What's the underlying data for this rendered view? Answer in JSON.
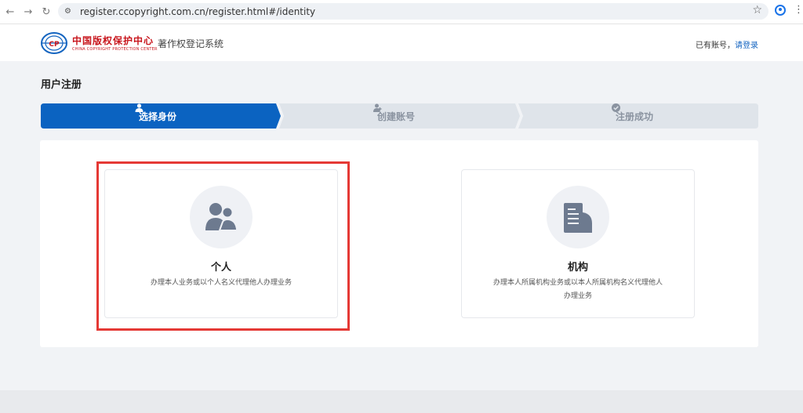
{
  "browser": {
    "url": "register.ccopyright.com.cn/register.html#/identity"
  },
  "header": {
    "logo_cn": "中国版权保护中心",
    "logo_en": "CHINA COPYRIGHT PROTECTION CENTER",
    "system_name": "著作权登记系统",
    "has_account": "已有账号，",
    "login_link": "请登录"
  },
  "page": {
    "title": "用户注册"
  },
  "steps": [
    {
      "label": "选择身份",
      "icon": "user-icon",
      "active": true
    },
    {
      "label": "创建账号",
      "icon": "user-plus-icon",
      "active": false
    },
    {
      "label": "注册成功",
      "icon": "check-circle-icon",
      "active": false
    }
  ],
  "cards": [
    {
      "title": "个人",
      "desc": "办理本人业务或以个人名义代理他人办理业务",
      "icon": "users-icon"
    },
    {
      "title": "机构",
      "desc_line1": "办理本人所属机构业务或以本人所属机构名义代理他人",
      "desc_line2": "办理业务",
      "icon": "document-icon"
    }
  ],
  "colors": {
    "active_step": "#0b63c1",
    "inactive_step": "#dfe4ea",
    "inactive_text": "#8a93a0",
    "highlight": "#e53935",
    "icon": "#6d7a8f"
  }
}
